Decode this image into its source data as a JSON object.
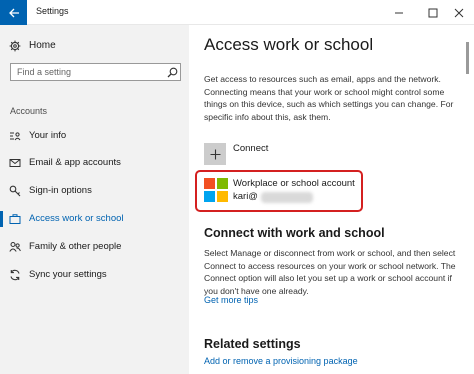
{
  "window": {
    "title": "Settings"
  },
  "sidebar": {
    "home_label": "Home",
    "search_placeholder": "Find a setting",
    "section_label": "Accounts",
    "items": [
      {
        "label": "Your info",
        "icon": "person-card-icon",
        "active": false
      },
      {
        "label": "Email & app accounts",
        "icon": "mail-icon",
        "active": false
      },
      {
        "label": "Sign-in options",
        "icon": "key-icon",
        "active": false
      },
      {
        "label": "Access work or school",
        "icon": "briefcase-icon",
        "active": true
      },
      {
        "label": "Family & other people",
        "icon": "people-icon",
        "active": false
      },
      {
        "label": "Sync your settings",
        "icon": "sync-icon",
        "active": false
      }
    ]
  },
  "main": {
    "title": "Access work or school",
    "intro": "Get access to resources such as email, apps and the network. Connecting means that your work or school might control some things on this device, such as which settings you can change. For specific info about this, ask them.",
    "connect_label": "Connect",
    "account": {
      "name": "Workplace or school account",
      "email_prefix": "kari@"
    },
    "section_heading": "Connect with work and school",
    "section_text": "Select Manage or disconnect from work or school, and then select Connect to access resources on your work or school network. The Connect option will also let you set up a work or school account if you don't have one already.",
    "tips_link": "Get more tips",
    "related_heading": "Related settings",
    "related_link": "Add or remove a provisioning package"
  },
  "colors": {
    "accent": "#0063b1",
    "highlight_border": "#d42020",
    "sidebar_bg": "#f2f2f2",
    "ms_logo": [
      "#f25022",
      "#7fba00",
      "#00a4ef",
      "#ffb900"
    ]
  }
}
